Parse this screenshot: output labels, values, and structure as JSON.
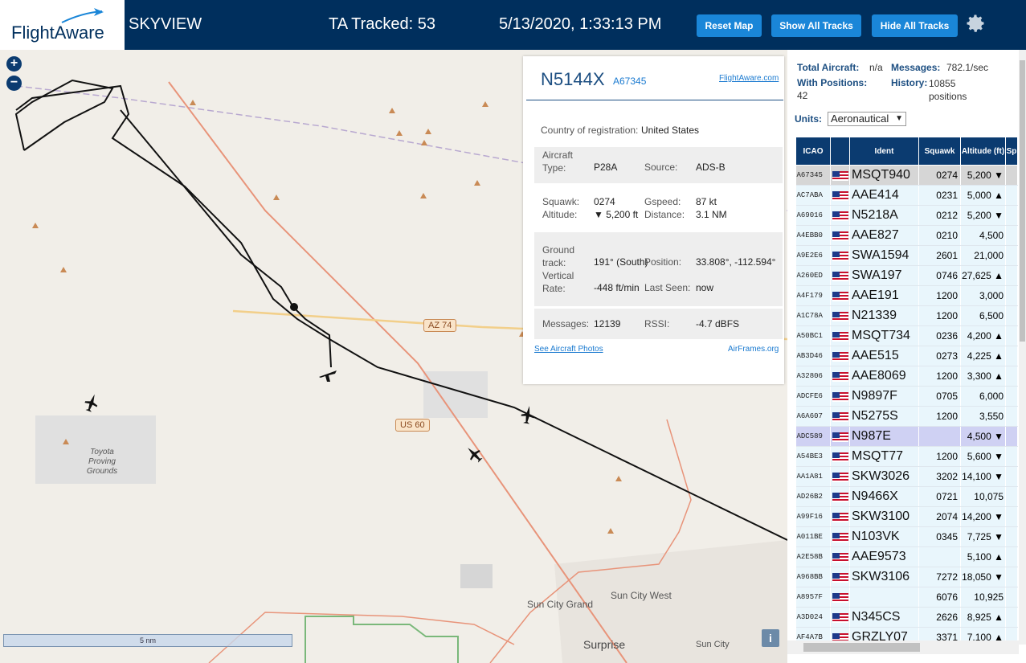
{
  "header": {
    "logo": "FlightAware",
    "app_name": "SKYVIEW",
    "tracked": "TA Tracked: 53",
    "datetime": "5/13/2020, 1:33:13 PM",
    "reset_label": "Reset Map",
    "show_label": "Show All Tracks",
    "hide_label": "Hide All Tracks"
  },
  "map": {
    "zoom_in": "+",
    "zoom_out": "−",
    "scale": "5 nm",
    "labels": {
      "toyota": "Toyota\nProving\nGrounds",
      "sun_city_grand": "Sun City Grand",
      "sun_city_west": "Sun City West",
      "surprise": "Surprise",
      "sun_city": "Sun City"
    },
    "shields": {
      "az74": "AZ 74",
      "us60": "US 60"
    },
    "info": "i"
  },
  "popup": {
    "ident": "N5144X",
    "hex": "A67345",
    "fa_link": "FlightAware.com",
    "country_label": "Country of registration:",
    "country": "United States",
    "aircraft_type_label": "Aircraft Type:",
    "aircraft_type": "P28A",
    "source_label": "Source:",
    "source": "ADS-B",
    "squawk_label": "Squawk:",
    "squawk": "0274",
    "gspeed_label": "Gspeed:",
    "gspeed": "87 kt",
    "altitude_label": "Altitude:",
    "altitude": "▼ 5,200 ft",
    "distance_label": "Distance:",
    "distance": "3.1 NM",
    "track_label": "Ground track:",
    "track": "191° (South)",
    "position_label": "Position:",
    "position": "33.808°, -112.594°",
    "vrate_label": "Vertical Rate:",
    "vrate": "-448 ft/min",
    "lastseen_label": "Last Seen:",
    "lastseen": "now",
    "messages_label": "Messages:",
    "messages": "12139",
    "rssi_label": "RSSI:",
    "rssi": "-4.7 dBFS",
    "photos_link": "See Aircraft Photos",
    "airframes_link": "AirFrames.org"
  },
  "sidebar": {
    "total_label": "Total Aircraft:",
    "total": "n/a",
    "messages_label": "Messages:",
    "messages": "782.1/sec",
    "positions_label": "With Positions:",
    "positions": "42",
    "history_label": "History:",
    "history": "10855 positions",
    "units_label": "Units:",
    "units_value": "Aeronautical",
    "columns": [
      "ICAO",
      "",
      "Ident",
      "Squawk",
      "Altitude (ft)",
      "Sp"
    ],
    "rows": [
      {
        "icao": "A67345",
        "ident": "MSQT940",
        "squawk": "0274",
        "alt": "5,200 ▼"
      },
      {
        "icao": "AC7ABA",
        "ident": "AAE414",
        "squawk": "0231",
        "alt": "5,000 ▲"
      },
      {
        "icao": "A69016",
        "ident": "N5218A",
        "squawk": "0212",
        "alt": "5,200 ▼"
      },
      {
        "icao": "A4EBB0",
        "ident": "AAE827",
        "squawk": "0210",
        "alt": "4,500"
      },
      {
        "icao": "A9E2E6",
        "ident": "SWA1594",
        "squawk": "2601",
        "alt": "21,000"
      },
      {
        "icao": "A260ED",
        "ident": "SWA197",
        "squawk": "0746",
        "alt": "27,625 ▲"
      },
      {
        "icao": "A4F179",
        "ident": "AAE191",
        "squawk": "1200",
        "alt": "3,000"
      },
      {
        "icao": "A1C78A",
        "ident": "N21339",
        "squawk": "1200",
        "alt": "6,500"
      },
      {
        "icao": "A50BC1",
        "ident": "MSQT734",
        "squawk": "0236",
        "alt": "4,200 ▲"
      },
      {
        "icao": "AB3D46",
        "ident": "AAE515",
        "squawk": "0273",
        "alt": "4,225 ▲"
      },
      {
        "icao": "A32806",
        "ident": "AAE8069",
        "squawk": "1200",
        "alt": "3,300 ▲"
      },
      {
        "icao": "ADCFE6",
        "ident": "N9897F",
        "squawk": "0705",
        "alt": "6,000"
      },
      {
        "icao": "A6A607",
        "ident": "N5275S",
        "squawk": "1200",
        "alt": "3,550"
      },
      {
        "icao": "ADC589",
        "ident": "N987E",
        "squawk": "",
        "alt": "4,500 ▼"
      },
      {
        "icao": "A54BE3",
        "ident": "MSQT77",
        "squawk": "1200",
        "alt": "5,600 ▼"
      },
      {
        "icao": "AA1A81",
        "ident": "SKW3026",
        "squawk": "3202",
        "alt": "14,100 ▼"
      },
      {
        "icao": "AD26B2",
        "ident": "N9466X",
        "squawk": "0721",
        "alt": "10,075"
      },
      {
        "icao": "A99F16",
        "ident": "SKW3100",
        "squawk": "2074",
        "alt": "14,200 ▼"
      },
      {
        "icao": "A011BE",
        "ident": "N103VK",
        "squawk": "0345",
        "alt": "7,725 ▼"
      },
      {
        "icao": "A2E58B",
        "ident": "AAE9573",
        "squawk": "",
        "alt": "5,100 ▲"
      },
      {
        "icao": "A968BB",
        "ident": "SKW3106",
        "squawk": "7272",
        "alt": "18,050 ▼"
      },
      {
        "icao": "A8957F",
        "ident": "",
        "squawk": "6076",
        "alt": "10,925"
      },
      {
        "icao": "A3D024",
        "ident": "N345CS",
        "squawk": "2626",
        "alt": "8,925 ▲"
      },
      {
        "icao": "AF4A7B",
        "ident": "GRZLY07",
        "squawk": "3371",
        "alt": "7,100 ▲"
      }
    ]
  },
  "colors": {
    "header_bg": "#002f5d",
    "button": "#1a86d8",
    "table_header": "#0b3b70",
    "row_bg": "#e9f6fc",
    "selected_row": "#d6d6d6"
  }
}
